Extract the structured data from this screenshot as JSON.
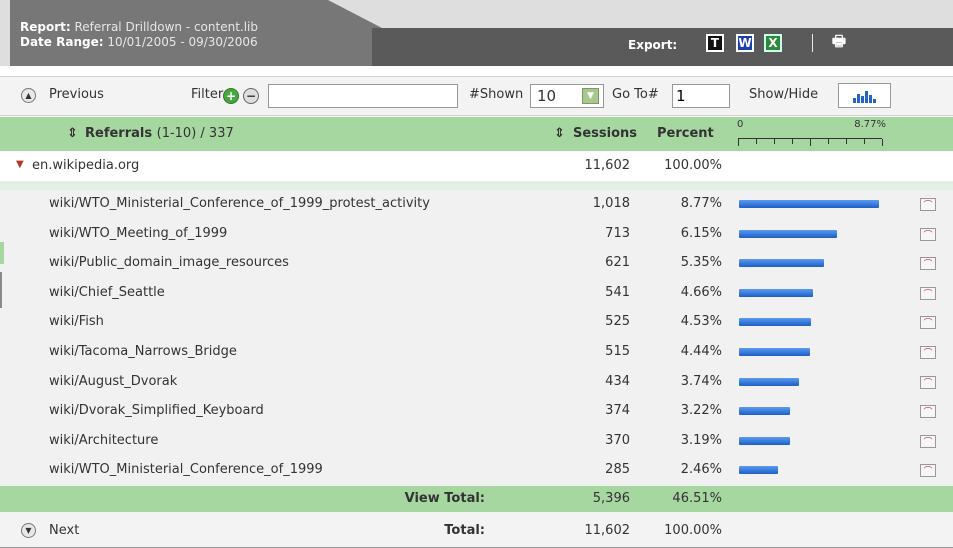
{
  "header": {
    "report_label": "Report:",
    "report_value": "Referral Drilldown - content.lib",
    "date_label": "Date Range:",
    "date_value": "10/01/2005 - 09/30/2006",
    "export_label": "Export:",
    "export_icons": {
      "text": "T",
      "word": "W",
      "excel": "X",
      "print": "🖶"
    }
  },
  "toolbar": {
    "previous_label": "Previous",
    "filter_label": "Filter",
    "filter_value": "",
    "shown_label": "#Shown",
    "shown_value": "10",
    "goto_label": "Go To#",
    "goto_value": "1",
    "showhide_label": "Show/Hide"
  },
  "columns": {
    "referrals_title": "Referrals",
    "referrals_range": "(1-10) / 337",
    "sessions": "Sessions",
    "percent": "Percent",
    "scale_min": "0",
    "scale_max": "8.77%"
  },
  "parent": {
    "name": "en.wikipedia.org",
    "sessions": "11,602",
    "percent": "100.00%"
  },
  "rows": [
    {
      "name": "wiki/WTO_Ministerial_Conference_of_1999_protest_activity",
      "sessions": "1,018",
      "percent": "8.77%",
      "share": 8.77
    },
    {
      "name": "wiki/WTO_Meeting_of_1999",
      "sessions": "713",
      "percent": "6.15%",
      "share": 6.15
    },
    {
      "name": "wiki/Public_domain_image_resources",
      "sessions": "621",
      "percent": "5.35%",
      "share": 5.35
    },
    {
      "name": "wiki/Chief_Seattle",
      "sessions": "541",
      "percent": "4.66%",
      "share": 4.66
    },
    {
      "name": "wiki/Fish",
      "sessions": "525",
      "percent": "4.53%",
      "share": 4.53
    },
    {
      "name": "wiki/Tacoma_Narrows_Bridge",
      "sessions": "515",
      "percent": "4.44%",
      "share": 4.44
    },
    {
      "name": "wiki/August_Dvorak",
      "sessions": "434",
      "percent": "3.74%",
      "share": 3.74
    },
    {
      "name": "wiki/Dvorak_Simplified_Keyboard",
      "sessions": "374",
      "percent": "3.22%",
      "share": 3.22
    },
    {
      "name": "wiki/Architecture",
      "sessions": "370",
      "percent": "3.19%",
      "share": 3.19
    },
    {
      "name": "wiki/WTO_Ministerial_Conference_of_1999",
      "sessions": "285",
      "percent": "2.46%",
      "share": 2.46
    }
  ],
  "view_total": {
    "label": "View Total:",
    "sessions": "5,396",
    "percent": "46.51%"
  },
  "footer": {
    "next_label": "Next",
    "total_label": "Total:",
    "sessions": "11,602",
    "percent": "100.00%"
  },
  "colors": {
    "header_dark": "#5a5a5a",
    "green_band": "#a7d7a0",
    "bar_blue": "#1c5fc8"
  }
}
